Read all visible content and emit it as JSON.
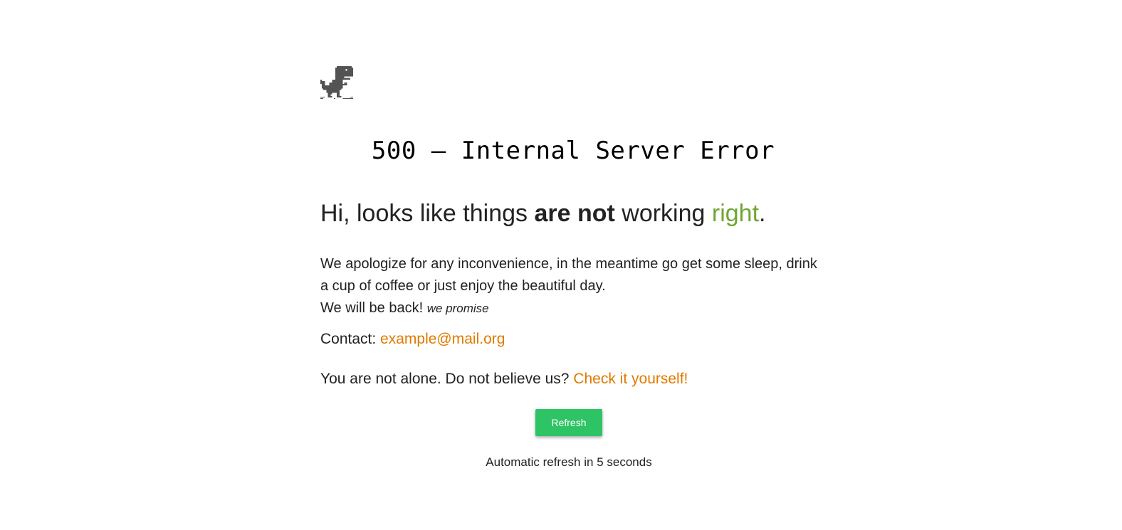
{
  "icons": {
    "dino": "dinosaur-icon"
  },
  "colors": {
    "accent_green": "#6fa632",
    "link_orange": "#e07a00",
    "button_green": "#2ec466",
    "text": "#222222"
  },
  "error_title": "500 – Internal Server Error",
  "headline": {
    "part1": "Hi, looks like things ",
    "bold": "are not",
    "part2": " working ",
    "accent": "right",
    "end": "."
  },
  "apology": {
    "line1": "We apologize for any inconvenience, in the meantime go get some sleep, drink a cup of coffee or just enjoy the beautiful day.",
    "line2": "We will be back! ",
    "promise": "we promise"
  },
  "contact": {
    "label": "Contact: ",
    "email": "example@mail.org"
  },
  "alone": {
    "text": "You are not alone. Do not believe us? ",
    "link": "Check it yourself!"
  },
  "refresh_button": "Refresh",
  "auto_refresh": {
    "prefix": "Automatic refresh in ",
    "seconds": "5",
    "suffix": " seconds"
  }
}
